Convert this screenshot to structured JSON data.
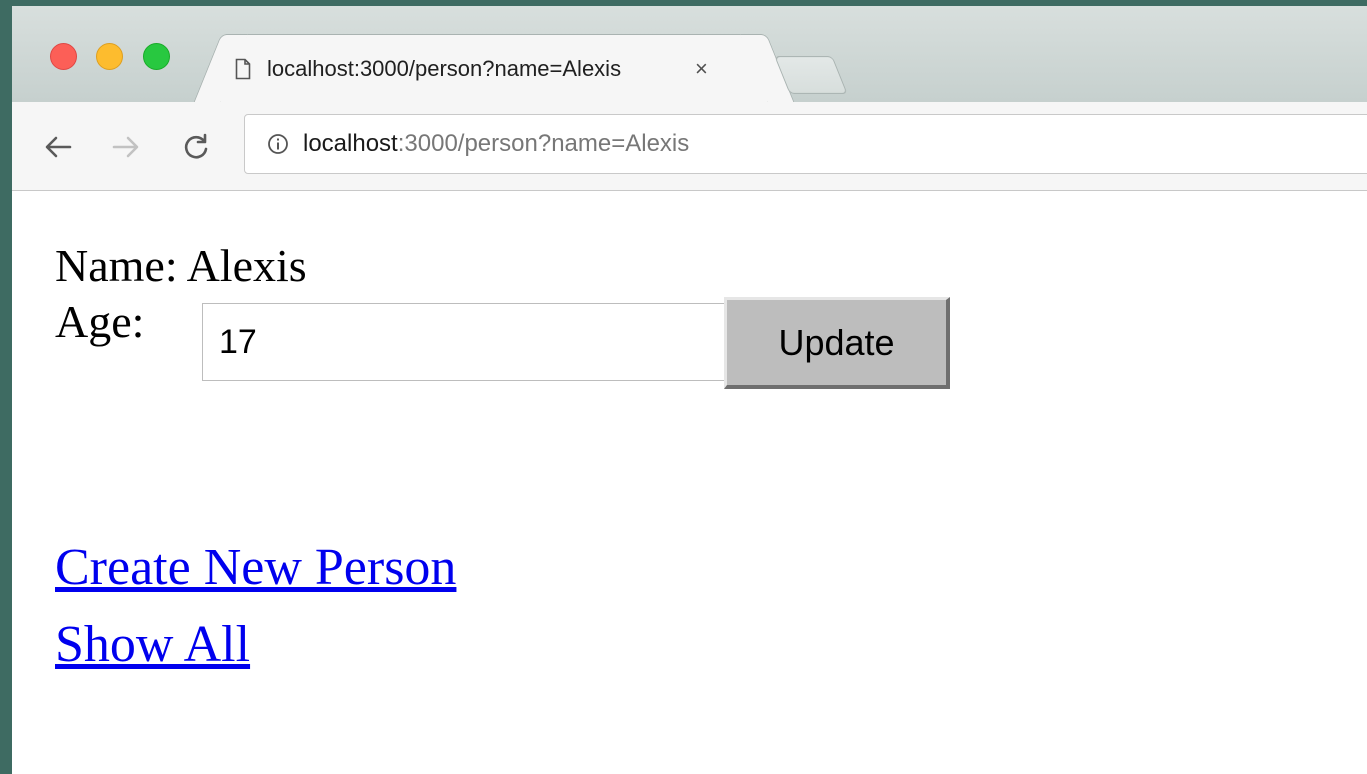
{
  "browser": {
    "tab": {
      "title": "localhost:3000/person?name=Alexis",
      "close_glyph": "×"
    },
    "toolbar": {
      "url_host": "localhost",
      "url_rest": ":3000/person?name=Alexis"
    },
    "colors": {
      "close": "#fc5f57",
      "minimize": "#fdbc2e",
      "zoom": "#28c840"
    }
  },
  "page": {
    "name_text": "Name: Alexis",
    "age_label": "Age:",
    "age_value": "17",
    "update_label": "Update",
    "links": {
      "create": "Create New Person",
      "show_all": "Show All"
    }
  }
}
